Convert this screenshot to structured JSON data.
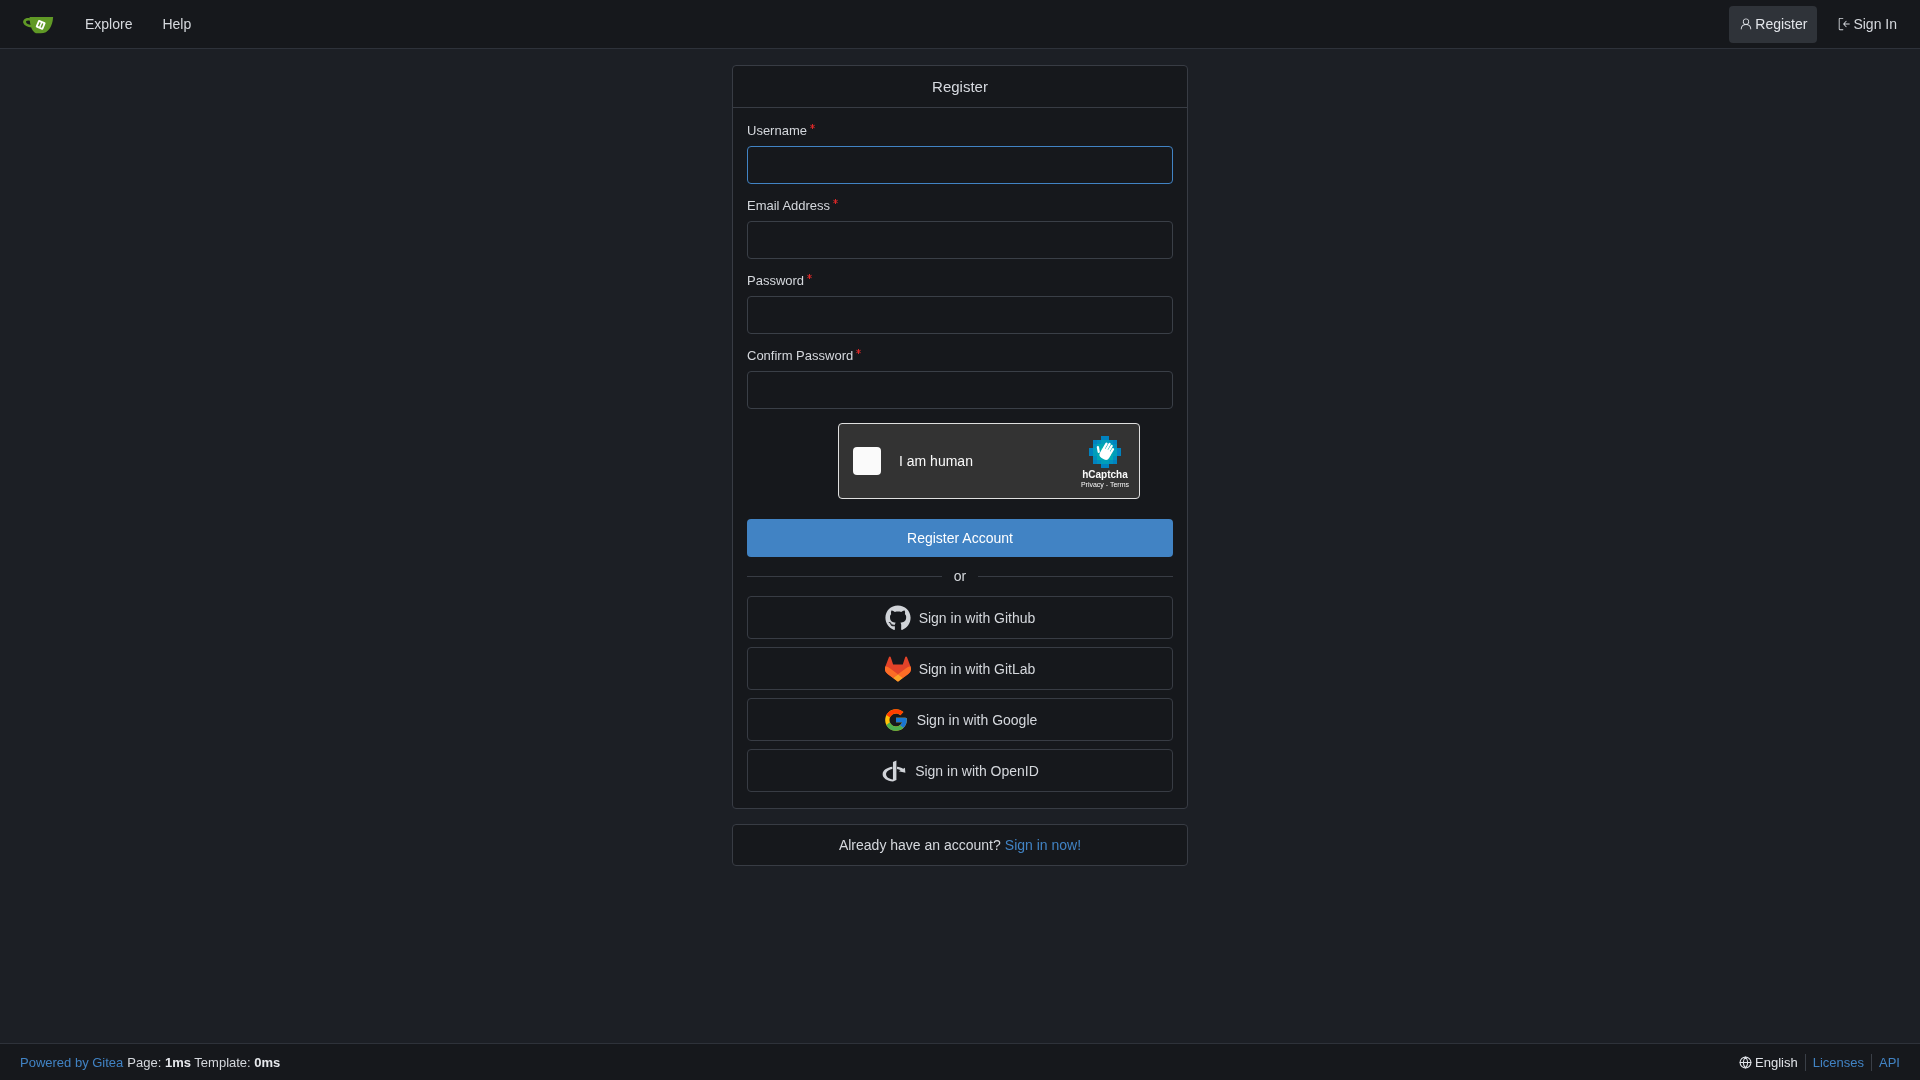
{
  "navbar": {
    "links": [
      {
        "label": "Explore"
      },
      {
        "label": "Help"
      }
    ],
    "actions": [
      {
        "kind": "register",
        "label": "Register",
        "selected": true
      },
      {
        "kind": "sign_in",
        "label": "Sign In",
        "selected": false
      }
    ]
  },
  "register_form": {
    "title": "Register",
    "fields": [
      {
        "label": "Username",
        "required": true,
        "focused": true
      },
      {
        "label": "Email Address",
        "required": true,
        "focused": false
      },
      {
        "label": "Password",
        "required": true,
        "focused": false
      },
      {
        "label": "Confirm Password",
        "required": true,
        "focused": false
      }
    ],
    "captcha": {
      "label": "I am human",
      "checked": false,
      "brand": "hCaptcha",
      "legal": "Privacy - Terms"
    },
    "submit": "Register Account",
    "divider": "or",
    "oauth_buttons": [
      {
        "kind": "github",
        "label": "Sign in with Github"
      },
      {
        "kind": "gitlab",
        "label": "Sign in with GitLab"
      },
      {
        "kind": "google",
        "label": "Sign in with Google"
      },
      {
        "kind": "openid",
        "label": "Sign in with OpenID"
      }
    ]
  },
  "signin_prompt": {
    "text": "Already have an account?",
    "link": "Sign in now!"
  },
  "footer": {
    "powered_by": "Powered by Gitea",
    "timing": "Page: **1ms** Template: **0ms**",
    "language": "English",
    "links": [
      "Licenses",
      "API"
    ]
  }
}
